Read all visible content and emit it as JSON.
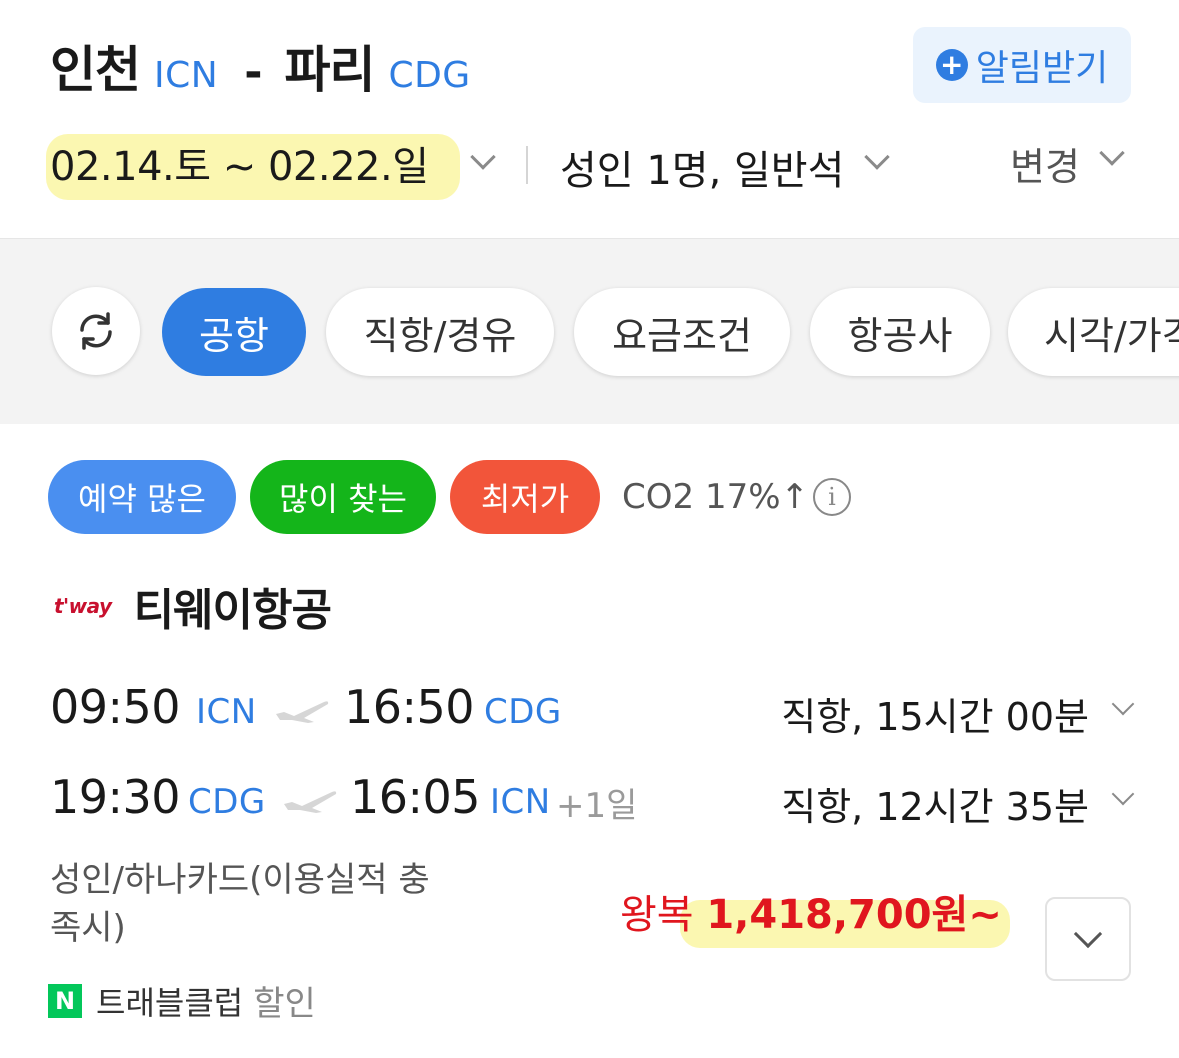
{
  "header": {
    "origin_city": "인천",
    "origin_code": "ICN",
    "separator": "-",
    "dest_city": "파리",
    "dest_code": "CDG",
    "alert_button": "알림받기",
    "dates": "02.14.토 ~ 02.22.일",
    "passengers": "성인 1명, 일반석",
    "change": "변경"
  },
  "filters": [
    {
      "label": "공항",
      "active": true
    },
    {
      "label": "직항/경유",
      "active": false
    },
    {
      "label": "요금조건",
      "active": false
    },
    {
      "label": "항공사",
      "active": false
    },
    {
      "label": "시각/가격",
      "active": false
    }
  ],
  "badges": [
    {
      "label": "예약 많은",
      "color": "#4a8ff0"
    },
    {
      "label": "많이 찾는",
      "color": "#14b51a"
    },
    {
      "label": "최저가",
      "color": "#f2553a"
    }
  ],
  "co2": {
    "label": "CO2 17%",
    "arrow": "↑",
    "info_icon": "info-circle-icon"
  },
  "airline": {
    "logo_text": "t'way",
    "name": "티웨이항공"
  },
  "legs": [
    {
      "dep_time": "09:50",
      "dep_code": "ICN",
      "arr_time": "16:50",
      "arr_code": "CDG",
      "day_offset": "",
      "duration": "직항, 15시간 00분"
    },
    {
      "dep_time": "19:30",
      "dep_code": "CDG",
      "arr_time": "16:05",
      "arr_code": "ICN",
      "day_offset": "+1일",
      "duration": "직항, 12시간 35분"
    }
  ],
  "fare_note": "성인/하나카드(이용실적 충족시)",
  "price": {
    "prefix": "왕복",
    "amount": "1,418,700원~"
  },
  "club": {
    "badge": "N",
    "name": "트래블클럽",
    "discount": "할인"
  },
  "colors": {
    "accent": "#2f7de1",
    "price": "#e0161e",
    "highlight": "#fbf6a8"
  }
}
